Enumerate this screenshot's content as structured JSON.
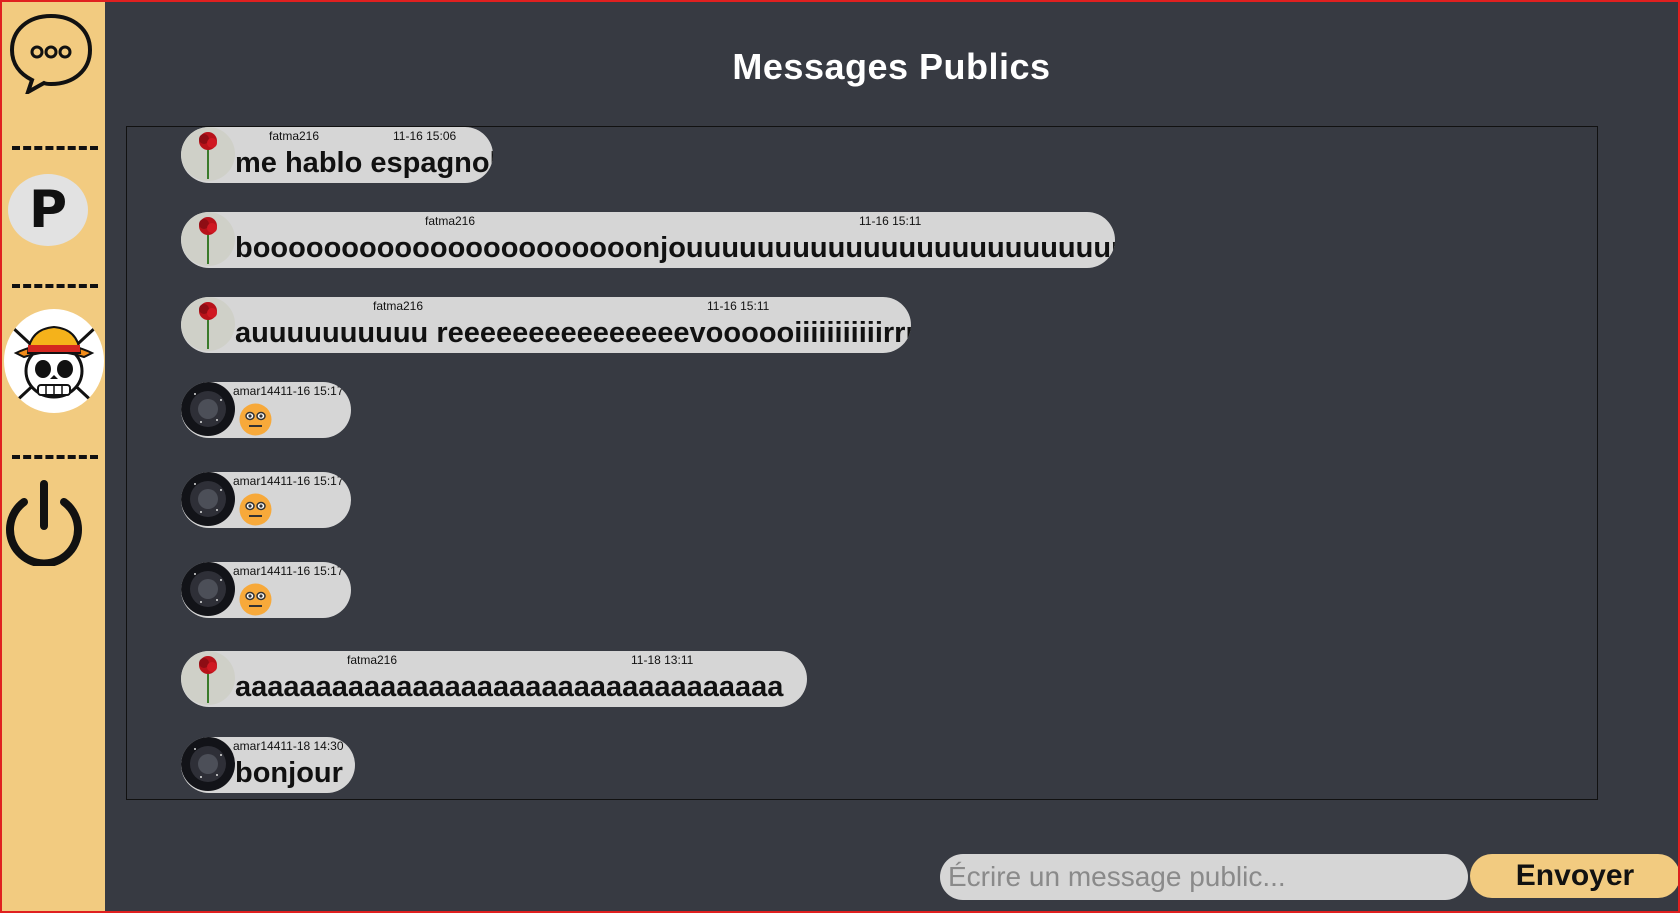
{
  "page": {
    "title": "Messages Publics"
  },
  "sidebar": {
    "items": [
      {
        "icon": "chat-bubble-icon"
      },
      {
        "icon": "profile-icon",
        "label": "P"
      },
      {
        "icon": "straw-hat-skull-avatar"
      },
      {
        "icon": "power-icon"
      }
    ]
  },
  "messages": [
    {
      "user": "fatma216",
      "time": "11-16 15:06",
      "text": "me hablo espagnol",
      "avatar": "rose"
    },
    {
      "user": "fatma216",
      "time": "11-16 15:11",
      "text": "boooooooooooooooooooooonjouuuuuuuuuuuuuuuuuuuuuuuur",
      "avatar": "rose"
    },
    {
      "user": "fatma216",
      "time": "11-16 15:11",
      "text": "auuuuuuuuuu reeeeeeeeeeeeeeevoooooiiiiiiiiiiirrr",
      "avatar": "rose"
    },
    {
      "user": "amar144",
      "time": "11-16 15:17",
      "meta": "amar14411-16 15:17",
      "text": "",
      "emoji": "neutral-face",
      "avatar": "galaxy"
    },
    {
      "user": "amar144",
      "time": "11-16 15:17",
      "meta": "amar14411-16 15:17",
      "text": "",
      "emoji": "neutral-face",
      "avatar": "galaxy"
    },
    {
      "user": "amar144",
      "time": "11-16 15:17",
      "meta": "amar14411-16 15:17",
      "text": "",
      "emoji": "neutral-face",
      "avatar": "galaxy"
    },
    {
      "user": "fatma216",
      "time": "11-18 13:11",
      "text": "aaaaaaaaaaaaaaaaaaaaaaaaaaaaaaaaaa",
      "avatar": "rose"
    },
    {
      "user": "amar144",
      "time": "11-18 14:30",
      "meta": "amar14411-18 14:30",
      "text": "bonjour",
      "avatar": "galaxy"
    }
  ],
  "composer": {
    "placeholder": "Écrire un message public...",
    "send_label": "Envoyer"
  },
  "colors": {
    "background": "#373a42",
    "sidebar": "#f2cb80",
    "bubble": "#d6d6d6",
    "accent_border": "#e02020"
  }
}
